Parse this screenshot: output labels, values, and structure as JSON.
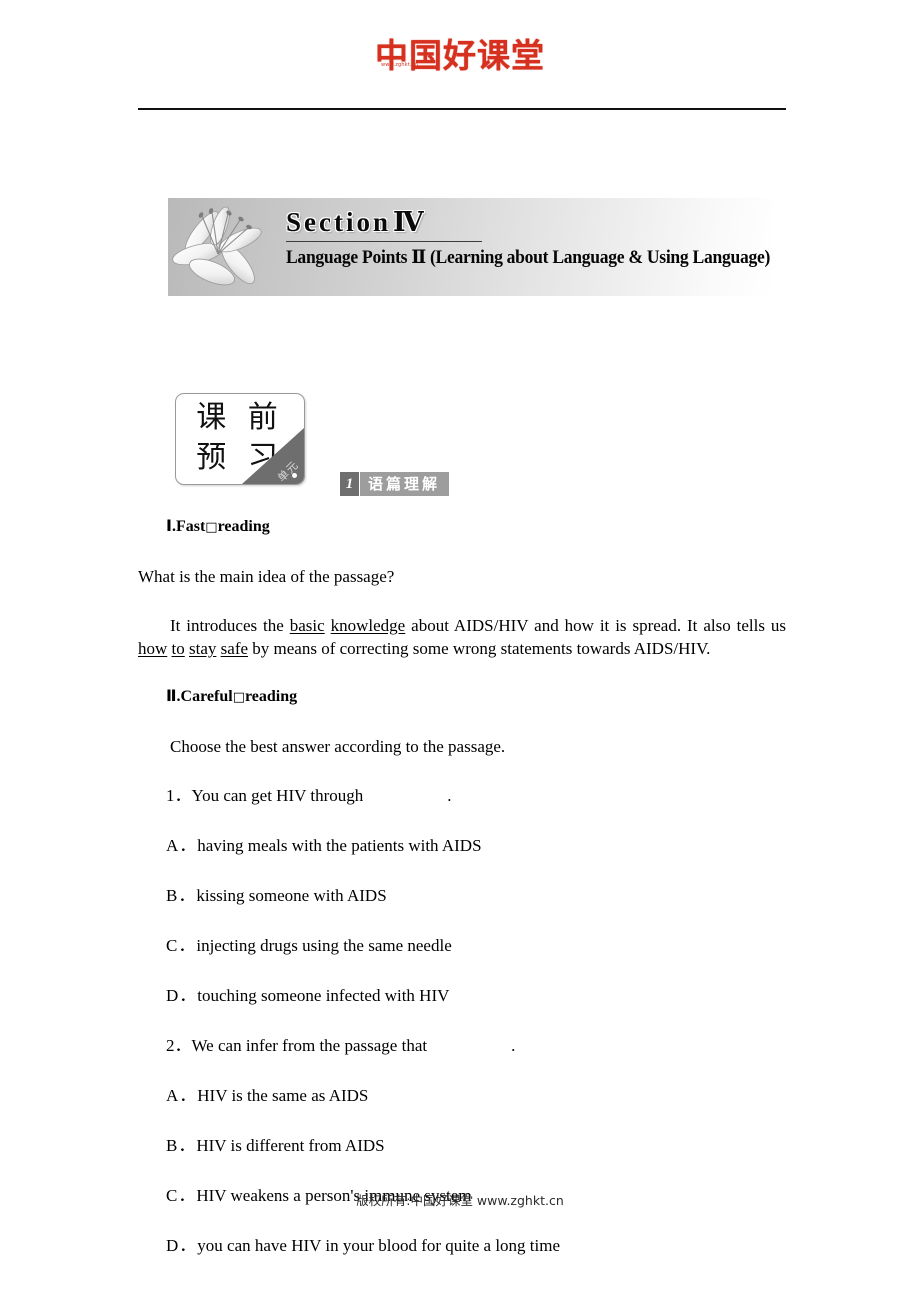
{
  "header": {
    "logo_text": "中国好课堂",
    "logo_sub": "www.zghkt.cn"
  },
  "banner": {
    "title_prefix": "Section",
    "title_number": "Ⅳ",
    "subtitle": "Language Points Ⅱ (Learning about Language & Using Language)"
  },
  "plate": {
    "text": "课 前\n预 习"
  },
  "topic": {
    "number": "1",
    "label": "语篇理解"
  },
  "sections": {
    "fast_reading": {
      "roman": "Ⅰ",
      "dot": ".",
      "title_a": "Fast",
      "boxchar": "□",
      "title_b": "reading",
      "question": "What is the main idea of the passage?",
      "answer_parts": [
        {
          "text": "It introduces the ",
          "underline": false
        },
        {
          "text": "basic",
          "underline": true
        },
        {
          "text": " ",
          "underline": false
        },
        {
          "text": "knowledge",
          "underline": true
        },
        {
          "text": " about AIDS/HIV and how it is spread. It also tells us ",
          "underline": false
        },
        {
          "text": "how",
          "underline": true
        },
        {
          "text": " ",
          "underline": false
        },
        {
          "text": "to",
          "underline": true
        },
        {
          "text": " ",
          "underline": false
        },
        {
          "text": "stay",
          "underline": true
        },
        {
          "text": " ",
          "underline": false
        },
        {
          "text": "safe",
          "underline": true
        },
        {
          "text": " by means of correcting some wrong statements towards AIDS/HIV.",
          "underline": false
        }
      ]
    },
    "careful_reading": {
      "roman": "Ⅱ",
      "dot": ".",
      "title_a": "Careful",
      "boxchar": "□",
      "title_b": "reading",
      "instruction": "Choose the best answer according to the passage.",
      "questions": [
        {
          "number": "1．",
          "stem": "You can get HIV through",
          "tail": ".",
          "options": [
            {
              "mark": "A．",
              "text": "having meals with the patients with AIDS"
            },
            {
              "mark": "B．",
              "text": "kissing someone with AIDS"
            },
            {
              "mark": "C．",
              "text": "injecting drugs using the same needle"
            },
            {
              "mark": "D．",
              "text": "touching someone infected with HIV"
            }
          ]
        },
        {
          "number": "2．",
          "stem": "We can infer from the passage that",
          "tail": ".",
          "options": [
            {
              "mark": "A．",
              "text": "HIV is the same as AIDS"
            },
            {
              "mark": "B．",
              "text": "HIV is different from AIDS"
            },
            {
              "mark": "C．",
              "text": "HIV weakens a person's immune system"
            },
            {
              "mark": "D．",
              "text": "you can have HIV in your blood for quite a long time"
            }
          ]
        }
      ]
    }
  },
  "footer": {
    "text": "版权所有:中国好课堂 www.zghkt.cn"
  }
}
